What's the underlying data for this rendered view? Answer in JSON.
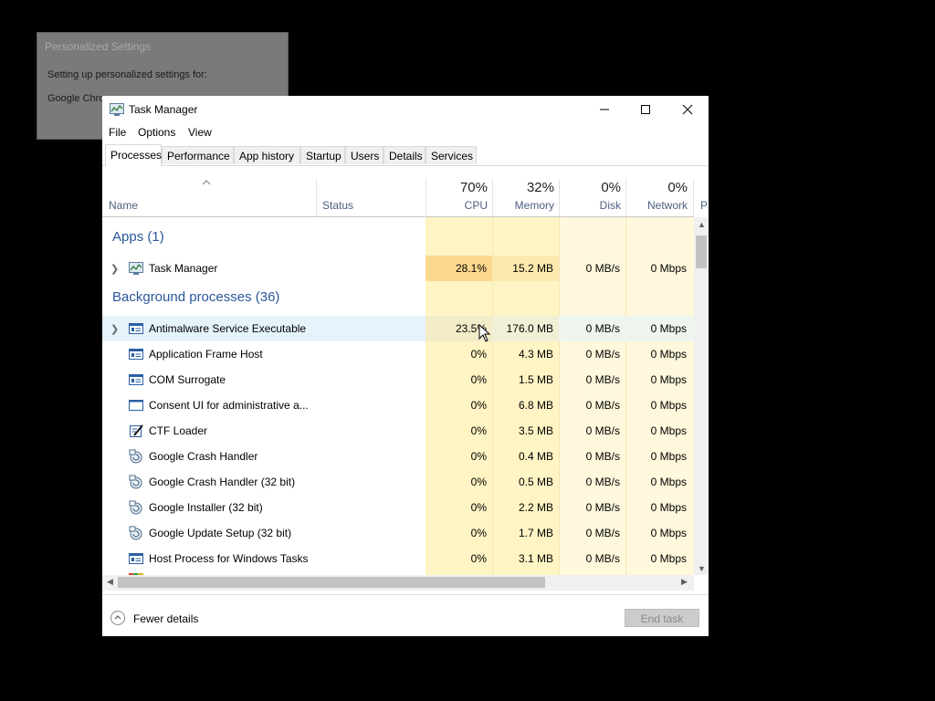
{
  "background_window": {
    "title": "Personalized Settings",
    "line1": "Setting up personalized settings for:",
    "line2": "Google Chrome"
  },
  "window": {
    "title": "Task Manager"
  },
  "menu": [
    "File",
    "Options",
    "View"
  ],
  "tabs": [
    "Processes",
    "Performance",
    "App history",
    "Startup",
    "Users",
    "Details",
    "Services"
  ],
  "header": {
    "name": "Name",
    "status": "Status",
    "cpu": {
      "pct": "70%",
      "label": "CPU"
    },
    "memory": {
      "pct": "32%",
      "label": "Memory"
    },
    "disk": {
      "pct": "0%",
      "label": "Disk"
    },
    "network": {
      "pct": "0%",
      "label": "Network"
    },
    "truncated": "P"
  },
  "groups": {
    "apps": "Apps (1)",
    "background": "Background processes (36)"
  },
  "apps": [
    {
      "name": "Task Manager",
      "cpu": "28.1%",
      "memory": "15.2 MB",
      "disk": "0 MB/s",
      "network": "0 Mbps",
      "icon": "task-manager-icon"
    }
  ],
  "processes": [
    {
      "name": "Antimalware Service Executable",
      "cpu": "23.5%",
      "memory": "176.0 MB",
      "disk": "0 MB/s",
      "network": "0 Mbps",
      "icon": "service-window-icon"
    },
    {
      "name": "Application Frame Host",
      "cpu": "0%",
      "memory": "4.3 MB",
      "disk": "0 MB/s",
      "network": "0 Mbps",
      "icon": "service-window-icon"
    },
    {
      "name": "COM Surrogate",
      "cpu": "0%",
      "memory": "1.5 MB",
      "disk": "0 MB/s",
      "network": "0 Mbps",
      "icon": "service-window-icon"
    },
    {
      "name": "Consent UI for administrative a...",
      "cpu": "0%",
      "memory": "6.8 MB",
      "disk": "0 MB/s",
      "network": "0 Mbps",
      "icon": "window-icon"
    },
    {
      "name": "CTF Loader",
      "cpu": "0%",
      "memory": "3.5 MB",
      "disk": "0 MB/s",
      "network": "0 Mbps",
      "icon": "pen-note-icon"
    },
    {
      "name": "Google Crash Handler",
      "cpu": "0%",
      "memory": "0.4 MB",
      "disk": "0 MB/s",
      "network": "0 Mbps",
      "icon": "google-update-icon"
    },
    {
      "name": "Google Crash Handler (32 bit)",
      "cpu": "0%",
      "memory": "0.5 MB",
      "disk": "0 MB/s",
      "network": "0 Mbps",
      "icon": "google-update-icon"
    },
    {
      "name": "Google Installer (32 bit)",
      "cpu": "0%",
      "memory": "2.2 MB",
      "disk": "0 MB/s",
      "network": "0 Mbps",
      "icon": "google-update-icon"
    },
    {
      "name": "Google Update Setup (32 bit)",
      "cpu": "0%",
      "memory": "1.7 MB",
      "disk": "0 MB/s",
      "network": "0 Mbps",
      "icon": "google-update-icon"
    },
    {
      "name": "Host Process for Windows Tasks",
      "cpu": "0%",
      "memory": "3.1 MB",
      "disk": "0 MB/s",
      "network": "0 Mbps",
      "icon": "service-window-icon"
    }
  ],
  "footer": {
    "fewer_details": "Fewer details",
    "end_task": "End task"
  },
  "colors": {
    "heat_dark": "#fcd88f",
    "heat_mid": "#fde9ae",
    "heat_light": "#fff4c4",
    "heat_faint": "#fff8dc",
    "selected_row": "#e5f3fb",
    "group_text": "#2b579a"
  }
}
